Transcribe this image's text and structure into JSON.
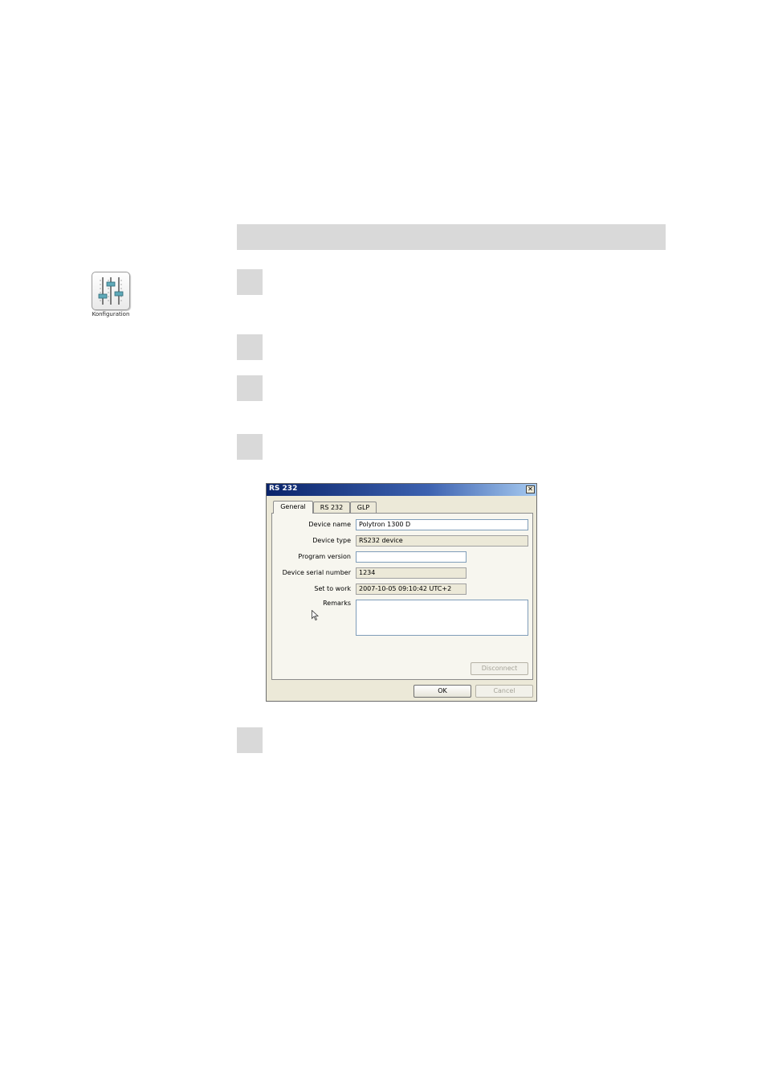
{
  "app_icon": {
    "label": "Konfiguration",
    "icon": "sliders-config-icon"
  },
  "dialog": {
    "title": "RS 232",
    "tabs": [
      {
        "label": "General",
        "active": true
      },
      {
        "label": "RS 232",
        "active": false
      },
      {
        "label": "GLP",
        "active": false
      }
    ],
    "fields": {
      "device_name": {
        "label": "Device name",
        "value": "Polytron 1300 D"
      },
      "device_type": {
        "label": "Device type",
        "value": "RS232 device"
      },
      "program_version": {
        "label": "Program version",
        "value": ""
      },
      "device_serial_number": {
        "label": "Device serial number",
        "value": "1234"
      },
      "set_to_work": {
        "label": "Set to work",
        "value": "2007-10-05 09:10:42 UTC+2"
      },
      "remarks": {
        "label": "Remarks",
        "value": ""
      }
    },
    "disconnect_label": "Disconnect",
    "ok_label": "OK",
    "cancel_label": "Cancel"
  }
}
